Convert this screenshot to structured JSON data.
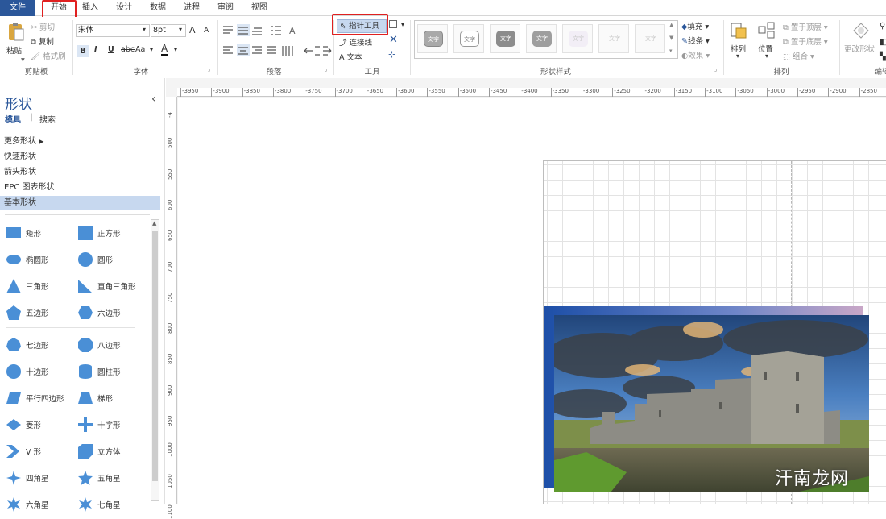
{
  "menubar": {
    "file": "文件",
    "tabs": [
      "开始",
      "插入",
      "设计",
      "数据",
      "进程",
      "审阅",
      "视图"
    ],
    "active_tab": "开始"
  },
  "ribbon": {
    "clipboard": {
      "paste": "粘贴",
      "cut": "剪切",
      "copy": "复制",
      "format_painter": "格式刷",
      "label": "剪贴板"
    },
    "font": {
      "font_name": "宋体",
      "font_size": "8pt",
      "bold": "B",
      "italic": "I",
      "underline": "U",
      "strike": "abc",
      "case": "Aa",
      "color": "A",
      "grow": "A",
      "shrink": "A",
      "label": "字体"
    },
    "paragraph": {
      "label": "段落"
    },
    "tools": {
      "pointer": "指针工具",
      "connector": "连接线",
      "text": "文本",
      "label": "工具"
    },
    "shape_styles": {
      "samples": [
        "文字",
        "文字",
        "文字",
        "文字",
        "文字",
        "文字",
        "文字"
      ],
      "label": "形状样式"
    },
    "format": {
      "fill": "填充",
      "line": "线条",
      "effect": "效果"
    },
    "arrange": {
      "arrange": "排列",
      "position": "位置",
      "bring_front": "置于顶层",
      "send_back": "置于底层",
      "group": "组合",
      "label": "排列"
    },
    "edit": {
      "change_shape": "更改形状",
      "label": "编辑"
    }
  },
  "sidebar": {
    "title": "形状",
    "collapse": "‹",
    "tabs": [
      "模具",
      "搜索"
    ],
    "stencils": [
      "更多形状",
      "快速形状",
      "箭头形状",
      "EPC 图表形状",
      "基本形状"
    ],
    "selected_stencil": "基本形状",
    "shapes": [
      [
        "矩形",
        "正方形"
      ],
      [
        "椭圆形",
        "圆形"
      ],
      [
        "三角形",
        "直角三角形"
      ],
      [
        "五边形",
        "六边形"
      ],
      [
        "七边形",
        "八边形"
      ],
      [
        "十边形",
        "圆柱形"
      ],
      [
        "平行四边形",
        "梯形"
      ],
      [
        "菱形",
        "十字形"
      ],
      [
        "V 形",
        "立方体"
      ],
      [
        "四角星",
        "五角星"
      ],
      [
        "六角星",
        "七角星"
      ]
    ]
  },
  "ruler": {
    "h_ticks": [
      "-3950",
      "-3900",
      "-3850",
      "-3800",
      "-3750",
      "-3700",
      "-3650",
      "-3600",
      "-3550",
      "-3500",
      "-3450",
      "-3400",
      "-3350",
      "-3300",
      "-3250",
      "-3200",
      "-3150",
      "-3100",
      "-3050",
      "-3000",
      "-2950",
      "-2900",
      "-2850"
    ],
    "v_ticks": [
      "-4",
      "500",
      "550",
      "600",
      "650",
      "700",
      "750",
      "800",
      "850",
      "900",
      "950",
      "1000",
      "1050",
      "1100"
    ]
  },
  "watermark": "汗南龙网",
  "colors": {
    "accent": "#2b579a",
    "highlight": "#e02020",
    "shape_fill": "#4a8fd6",
    "selected": "#c7d8ef"
  }
}
